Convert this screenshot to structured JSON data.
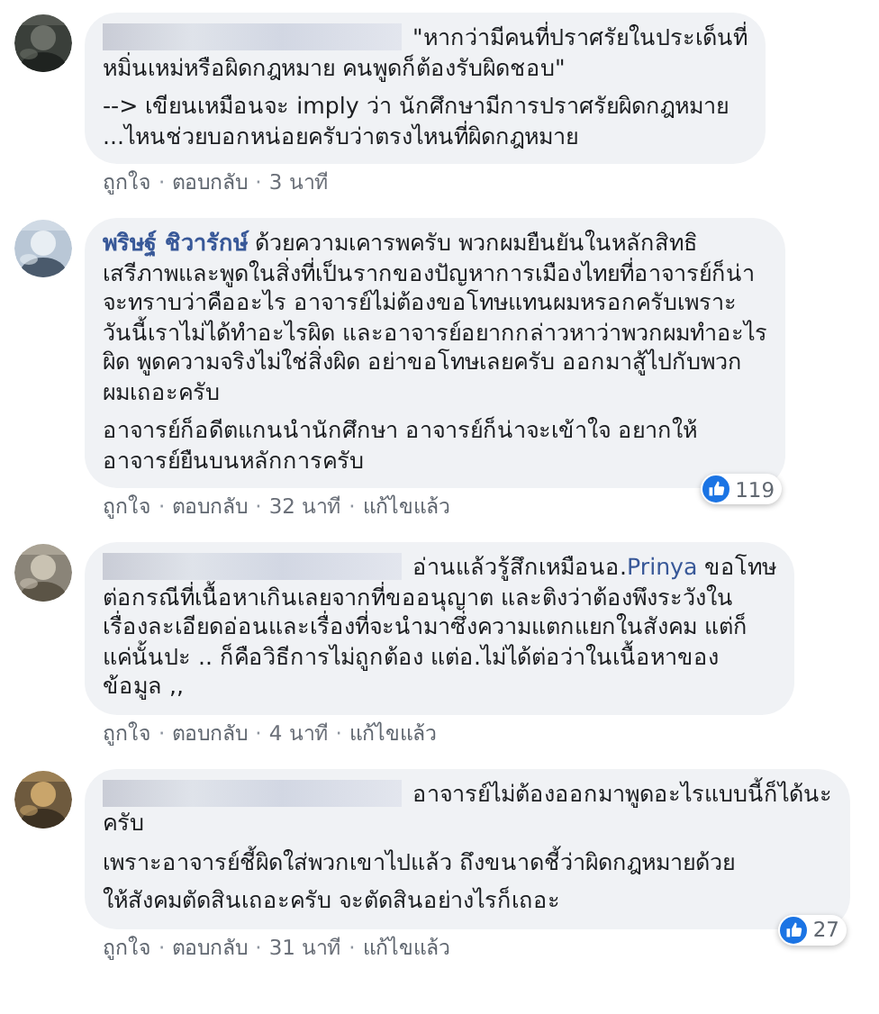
{
  "comments": [
    {
      "author_hidden": true,
      "paragraphs": [
        [
          {
            "kind": "text",
            "text": "\"หากว่ามีคนที่ปราศรัยในประเด็นที่\nหมิ่นเหม่หรือผิดกฎหมาย คนพูดก็ต้องรับผิดชอบ\""
          }
        ],
        [
          {
            "kind": "text",
            "text": "--> เขียนเหมือนจะ imply ว่า นักศึกษามีการปราศรัยผิดกฎหมาย\n...ไหนช่วยบอกหน่อยครับว่าตรงไหนที่ผิดกฎหมาย"
          }
        ]
      ],
      "actions": [
        {
          "kind": "link",
          "label": "ถูกใจ"
        },
        {
          "kind": "dot",
          "label": "·"
        },
        {
          "kind": "link",
          "label": "ตอบกลับ"
        },
        {
          "kind": "dot",
          "label": "·"
        },
        {
          "kind": "time",
          "label": "3 นาที"
        }
      ]
    },
    {
      "author": "พริษฐ์ ชิวารักษ์",
      "paragraphs": [
        [
          {
            "kind": "text",
            "text": "ด้วยความเคารพครับ พวกผมยืนยันในหลักสิทธิ\nเสรีภาพและพูดในสิ่งที่เป็นรากของปัญหาการเมืองไทยที่อาจารย์ก็น่า\nจะทราบว่าคืออะไร อาจารย์ไม่ต้องขอโทษแทนผมหรอกครับเพราะ\nวันนี้เราไม่ได้ทำอะไรผิด และอาจารย์อยากกล่าวหาว่าพวกผมทำอะไร\nผิด พูดความจริงไม่ใช่สิ่งผิด อย่าขอโทษเลยครับ ออกมาสู้ไปกับพวก\nผมเถอะครับ"
          }
        ],
        [
          {
            "kind": "text",
            "text": "อาจารย์ก็อดีตแกนนำนักศึกษา อาจารย์ก็น่าจะเข้าใจ อยากให้\nอาจารย์ยืนบนหลักการครับ"
          }
        ]
      ],
      "reactions": "119",
      "actions": [
        {
          "kind": "link",
          "label": "ถูกใจ"
        },
        {
          "kind": "dot",
          "label": "·"
        },
        {
          "kind": "link",
          "label": "ตอบกลับ"
        },
        {
          "kind": "dot",
          "label": "·"
        },
        {
          "kind": "time",
          "label": "32 นาที"
        },
        {
          "kind": "dot",
          "label": "·"
        },
        {
          "kind": "link",
          "label": "แก้ไขแล้ว"
        }
      ]
    },
    {
      "author_hidden": true,
      "paragraphs": [
        [
          {
            "kind": "text",
            "text": "อ่านแล้วรู้สึกเหมือนอ."
          },
          {
            "kind": "mention",
            "text": "Prinya"
          },
          {
            "kind": "text",
            "text": " ขอโทษ\nต่อกรณีที่เนื้อหาเกินเลยจากที่ขออนุญาต และติงว่าต้องพึงระวังใน\nเรื่องละเอียดอ่อนและเรื่องที่จะนำมาซึ่งความแตกแยกในสังคม แต่ก็\nแค่นั้นปะ .. ก็คือวิธีการไม่ถูกต้อง แต่อ.ไม่ได้ต่อว่าในเนื้อหาของ\nข้อมูล ,,"
          }
        ]
      ],
      "actions": [
        {
          "kind": "link",
          "label": "ถูกใจ"
        },
        {
          "kind": "dot",
          "label": "·"
        },
        {
          "kind": "link",
          "label": "ตอบกลับ"
        },
        {
          "kind": "dot",
          "label": "·"
        },
        {
          "kind": "time",
          "label": "4 นาที"
        },
        {
          "kind": "dot",
          "label": "·"
        },
        {
          "kind": "link",
          "label": "แก้ไขแล้ว"
        }
      ]
    },
    {
      "author_hidden": true,
      "paragraphs": [
        [
          {
            "kind": "text",
            "text": "อาจารย์ไม่ต้องออกมาพูดอะไรแบบนี้ก็ได้นะ\nครับ"
          }
        ],
        [
          {
            "kind": "text",
            "text": "เพราะอาจารย์ชี้ผิดใส่พวกเขาไปแล้ว ถึงขนาดชี้ว่าผิดกฎหมายด้วย"
          }
        ],
        [
          {
            "kind": "text",
            "text": "ให้สังคมตัดสินเถอะครับ จะตัดสินอย่างไรก็เถอะ"
          }
        ]
      ],
      "reactions": "27",
      "actions": [
        {
          "kind": "link",
          "label": "ถูกใจ"
        },
        {
          "kind": "dot",
          "label": "·"
        },
        {
          "kind": "link",
          "label": "ตอบกลับ"
        },
        {
          "kind": "dot",
          "label": "·"
        },
        {
          "kind": "time",
          "label": "31 นาที"
        },
        {
          "kind": "dot",
          "label": "·"
        },
        {
          "kind": "link",
          "label": "แก้ไขแล้ว"
        }
      ]
    }
  ]
}
